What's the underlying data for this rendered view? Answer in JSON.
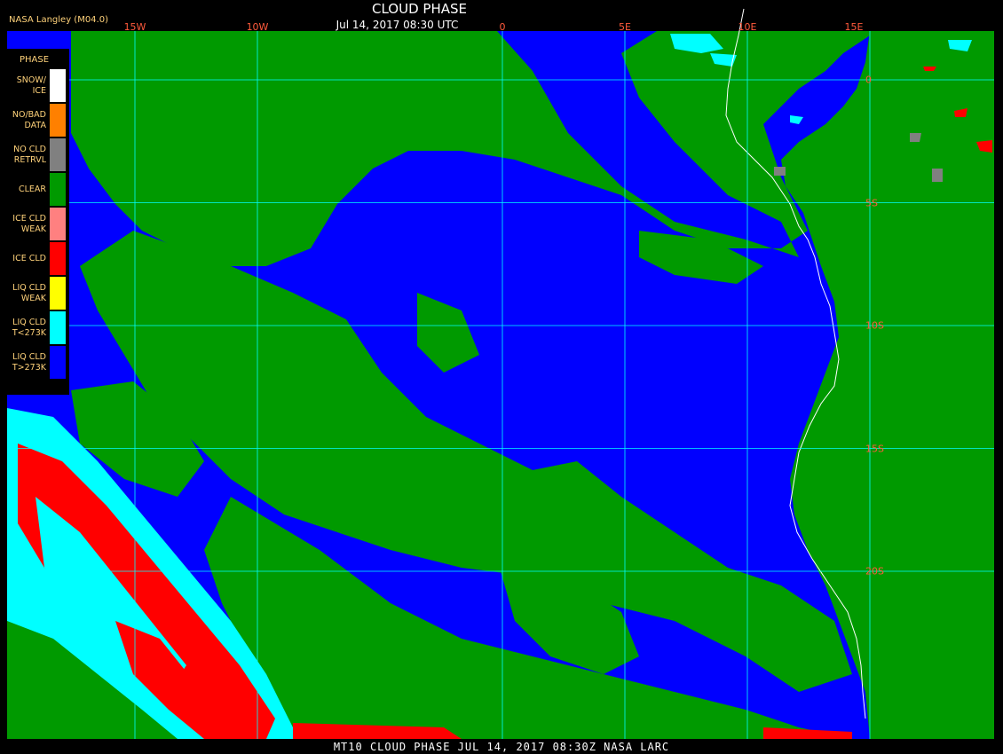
{
  "header": {
    "agency": "NASA Langley (M04.0)",
    "title": "CLOUD PHASE",
    "date": "Jul 14, 2017 08:30 UTC"
  },
  "footer": {
    "text": "MT10  CLOUD PHASE  JUL 14, 2017 08:30Z  NASA LARC"
  },
  "grid": {
    "longitudes": [
      {
        "label": "15W",
        "value": -15
      },
      {
        "label": "10W",
        "value": -10
      },
      {
        "label": "0",
        "value": 0
      },
      {
        "label": "5E",
        "value": 5
      },
      {
        "label": "10E",
        "value": 10
      },
      {
        "label": "15E",
        "value": 15
      }
    ],
    "latitudes": [
      {
        "label": "0",
        "value": 0
      },
      {
        "label": "5S",
        "value": -5
      },
      {
        "label": "10S",
        "value": -10
      },
      {
        "label": "15S",
        "value": -15
      },
      {
        "label": "20S",
        "value": -20
      }
    ],
    "line_color": "#00ffff",
    "label_color": "#ff5a3c"
  },
  "legend": {
    "title": "PHASE",
    "items": [
      {
        "label": "SNOW/\nICE",
        "color": "#ffffff"
      },
      {
        "label": "NO/BAD\nDATA",
        "color": "#ff8000"
      },
      {
        "label": "NO CLD\nRETRVL",
        "color": "#808080"
      },
      {
        "label": "CLEAR",
        "color": "#009a00"
      },
      {
        "label": "ICE CLD\nWEAK",
        "color": "#ff8080"
      },
      {
        "label": "ICE CLD",
        "color": "#ff0000"
      },
      {
        "label": "LIQ CLD\nWEAK",
        "color": "#ffff00"
      },
      {
        "label": "LIQ CLD\nT<273K",
        "color": "#00ffff"
      },
      {
        "label": "LIQ CLD\nT>273K",
        "color": "#0000ff"
      }
    ]
  },
  "colors": {
    "ocean_liquid_warm": "#0000ff",
    "clear": "#009a00",
    "ice": "#ff0000",
    "liquid_cold": "#00ffff",
    "coastline": "#ffffff"
  }
}
